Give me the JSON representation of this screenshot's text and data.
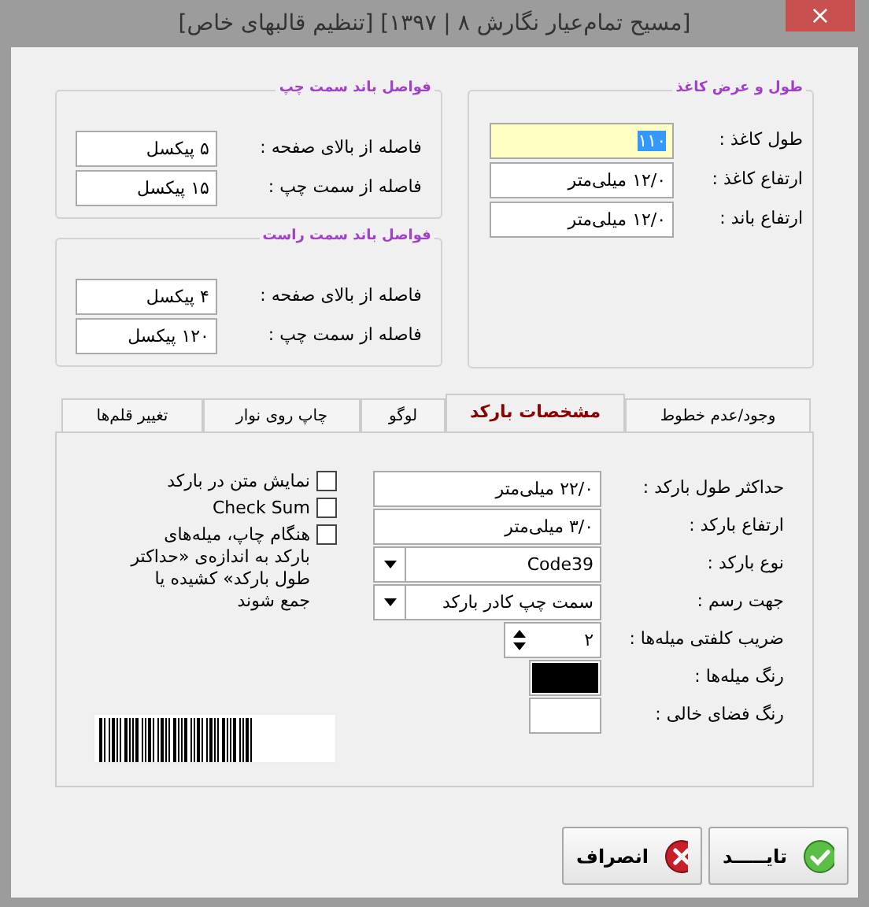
{
  "window": {
    "title": "[مسیح تمام‌عیار نگارش ۸ | ۱۳۹۷] [تنظیم قالبهای خاص]",
    "close": "×"
  },
  "paper_group": {
    "title": "طول و عرض کاغذ",
    "fields": [
      {
        "label": "طول کاغذ :",
        "value": "۱۱۰",
        "focused": true
      },
      {
        "label": "ارتفاع کاغذ :",
        "value": "۱۲/۰ میلی‌متر",
        "focused": false
      },
      {
        "label": "ارتفاع باند :",
        "value": "۱۲/۰ میلی‌متر",
        "focused": false
      }
    ]
  },
  "margin_groups": [
    {
      "title": "فواصل باند سمت چپ",
      "fields": [
        {
          "label": "فاصله از بالای صفحه :",
          "value": "۵ پیکسل",
          "focused": false
        },
        {
          "label": "فاصله از سمت چپ :",
          "value": "۱۵ پیکسل",
          "focused": false
        }
      ]
    },
    {
      "title": "فواصل باند سمت راست",
      "fields": [
        {
          "label": "فاصله از بالای صفحه :",
          "value": "۴ پیکسل",
          "focused": false
        },
        {
          "label": "فاصله از سمت چپ :",
          "value": "۱۲۰ پیکسل",
          "focused": false
        }
      ]
    }
  ],
  "tabs": [
    {
      "label": "وجود/عدم خطوط",
      "selected": false
    },
    {
      "label": "مشخصات بارکد",
      "selected": true
    },
    {
      "label": "لوگو",
      "selected": false
    },
    {
      "label": "چاپ روی نوار",
      "selected": false
    },
    {
      "label": "تغییر قلم‌ها",
      "selected": false
    }
  ],
  "barcode_settings": [
    {
      "kind": "text",
      "label": "حداکثر طول بارکد :",
      "value": "۲۲/۰ میلی‌متر"
    },
    {
      "kind": "text",
      "label": "ارتفاع بارکد :",
      "value": "۳/۰ میلی‌متر"
    },
    {
      "kind": "combo",
      "label": "نوع بارکد :",
      "value": "Code39"
    },
    {
      "kind": "combo",
      "label": "جهت رسم :",
      "value": "سمت چپ کادر بارکد"
    },
    {
      "kind": "spin",
      "label": "ضریب کلفتی میله‌ها :",
      "value": "۲"
    },
    {
      "kind": "color",
      "label": "رنگ میله‌ها :",
      "color": "#000000"
    },
    {
      "kind": "color",
      "label": "رنگ فضای خالی :",
      "color": "#ffffff"
    }
  ],
  "options": [
    {
      "label": "نمایش متن در بارکد",
      "checked": false
    },
    {
      "label": "Check Sum",
      "checked": false
    },
    {
      "label": "هنگام چاپ، میله‌های بارکد به اندازه‌ی «حداکتر طول بارکد» کشیده یا جمع شوند",
      "checked": false
    }
  ],
  "buttons": [
    {
      "kind": "ok",
      "label": "تایـــــد"
    },
    {
      "kind": "cancel",
      "label": "انصراف"
    }
  ]
}
